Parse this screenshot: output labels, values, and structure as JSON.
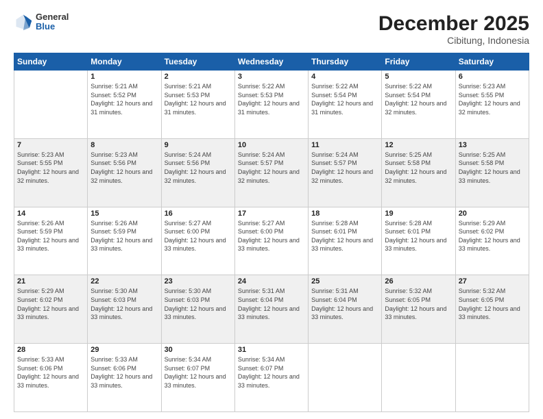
{
  "header": {
    "logo_general": "General",
    "logo_blue": "Blue",
    "main_title": "December 2025",
    "subtitle": "Cibitung, Indonesia"
  },
  "calendar": {
    "days_of_week": [
      "Sunday",
      "Monday",
      "Tuesday",
      "Wednesday",
      "Thursday",
      "Friday",
      "Saturday"
    ],
    "weeks": [
      [
        {
          "day": "",
          "sunrise": "",
          "sunset": "",
          "daylight": ""
        },
        {
          "day": "1",
          "sunrise": "Sunrise: 5:21 AM",
          "sunset": "Sunset: 5:52 PM",
          "daylight": "Daylight: 12 hours and 31 minutes."
        },
        {
          "day": "2",
          "sunrise": "Sunrise: 5:21 AM",
          "sunset": "Sunset: 5:53 PM",
          "daylight": "Daylight: 12 hours and 31 minutes."
        },
        {
          "day": "3",
          "sunrise": "Sunrise: 5:22 AM",
          "sunset": "Sunset: 5:53 PM",
          "daylight": "Daylight: 12 hours and 31 minutes."
        },
        {
          "day": "4",
          "sunrise": "Sunrise: 5:22 AM",
          "sunset": "Sunset: 5:54 PM",
          "daylight": "Daylight: 12 hours and 31 minutes."
        },
        {
          "day": "5",
          "sunrise": "Sunrise: 5:22 AM",
          "sunset": "Sunset: 5:54 PM",
          "daylight": "Daylight: 12 hours and 32 minutes."
        },
        {
          "day": "6",
          "sunrise": "Sunrise: 5:23 AM",
          "sunset": "Sunset: 5:55 PM",
          "daylight": "Daylight: 12 hours and 32 minutes."
        }
      ],
      [
        {
          "day": "7",
          "sunrise": "Sunrise: 5:23 AM",
          "sunset": "Sunset: 5:55 PM",
          "daylight": "Daylight: 12 hours and 32 minutes."
        },
        {
          "day": "8",
          "sunrise": "Sunrise: 5:23 AM",
          "sunset": "Sunset: 5:56 PM",
          "daylight": "Daylight: 12 hours and 32 minutes."
        },
        {
          "day": "9",
          "sunrise": "Sunrise: 5:24 AM",
          "sunset": "Sunset: 5:56 PM",
          "daylight": "Daylight: 12 hours and 32 minutes."
        },
        {
          "day": "10",
          "sunrise": "Sunrise: 5:24 AM",
          "sunset": "Sunset: 5:57 PM",
          "daylight": "Daylight: 12 hours and 32 minutes."
        },
        {
          "day": "11",
          "sunrise": "Sunrise: 5:24 AM",
          "sunset": "Sunset: 5:57 PM",
          "daylight": "Daylight: 12 hours and 32 minutes."
        },
        {
          "day": "12",
          "sunrise": "Sunrise: 5:25 AM",
          "sunset": "Sunset: 5:58 PM",
          "daylight": "Daylight: 12 hours and 32 minutes."
        },
        {
          "day": "13",
          "sunrise": "Sunrise: 5:25 AM",
          "sunset": "Sunset: 5:58 PM",
          "daylight": "Daylight: 12 hours and 33 minutes."
        }
      ],
      [
        {
          "day": "14",
          "sunrise": "Sunrise: 5:26 AM",
          "sunset": "Sunset: 5:59 PM",
          "daylight": "Daylight: 12 hours and 33 minutes."
        },
        {
          "day": "15",
          "sunrise": "Sunrise: 5:26 AM",
          "sunset": "Sunset: 5:59 PM",
          "daylight": "Daylight: 12 hours and 33 minutes."
        },
        {
          "day": "16",
          "sunrise": "Sunrise: 5:27 AM",
          "sunset": "Sunset: 6:00 PM",
          "daylight": "Daylight: 12 hours and 33 minutes."
        },
        {
          "day": "17",
          "sunrise": "Sunrise: 5:27 AM",
          "sunset": "Sunset: 6:00 PM",
          "daylight": "Daylight: 12 hours and 33 minutes."
        },
        {
          "day": "18",
          "sunrise": "Sunrise: 5:28 AM",
          "sunset": "Sunset: 6:01 PM",
          "daylight": "Daylight: 12 hours and 33 minutes."
        },
        {
          "day": "19",
          "sunrise": "Sunrise: 5:28 AM",
          "sunset": "Sunset: 6:01 PM",
          "daylight": "Daylight: 12 hours and 33 minutes."
        },
        {
          "day": "20",
          "sunrise": "Sunrise: 5:29 AM",
          "sunset": "Sunset: 6:02 PM",
          "daylight": "Daylight: 12 hours and 33 minutes."
        }
      ],
      [
        {
          "day": "21",
          "sunrise": "Sunrise: 5:29 AM",
          "sunset": "Sunset: 6:02 PM",
          "daylight": "Daylight: 12 hours and 33 minutes."
        },
        {
          "day": "22",
          "sunrise": "Sunrise: 5:30 AM",
          "sunset": "Sunset: 6:03 PM",
          "daylight": "Daylight: 12 hours and 33 minutes."
        },
        {
          "day": "23",
          "sunrise": "Sunrise: 5:30 AM",
          "sunset": "Sunset: 6:03 PM",
          "daylight": "Daylight: 12 hours and 33 minutes."
        },
        {
          "day": "24",
          "sunrise": "Sunrise: 5:31 AM",
          "sunset": "Sunset: 6:04 PM",
          "daylight": "Daylight: 12 hours and 33 minutes."
        },
        {
          "day": "25",
          "sunrise": "Sunrise: 5:31 AM",
          "sunset": "Sunset: 6:04 PM",
          "daylight": "Daylight: 12 hours and 33 minutes."
        },
        {
          "day": "26",
          "sunrise": "Sunrise: 5:32 AM",
          "sunset": "Sunset: 6:05 PM",
          "daylight": "Daylight: 12 hours and 33 minutes."
        },
        {
          "day": "27",
          "sunrise": "Sunrise: 5:32 AM",
          "sunset": "Sunset: 6:05 PM",
          "daylight": "Daylight: 12 hours and 33 minutes."
        }
      ],
      [
        {
          "day": "28",
          "sunrise": "Sunrise: 5:33 AM",
          "sunset": "Sunset: 6:06 PM",
          "daylight": "Daylight: 12 hours and 33 minutes."
        },
        {
          "day": "29",
          "sunrise": "Sunrise: 5:33 AM",
          "sunset": "Sunset: 6:06 PM",
          "daylight": "Daylight: 12 hours and 33 minutes."
        },
        {
          "day": "30",
          "sunrise": "Sunrise: 5:34 AM",
          "sunset": "Sunset: 6:07 PM",
          "daylight": "Daylight: 12 hours and 33 minutes."
        },
        {
          "day": "31",
          "sunrise": "Sunrise: 5:34 AM",
          "sunset": "Sunset: 6:07 PM",
          "daylight": "Daylight: 12 hours and 33 minutes."
        },
        {
          "day": "",
          "sunrise": "",
          "sunset": "",
          "daylight": ""
        },
        {
          "day": "",
          "sunrise": "",
          "sunset": "",
          "daylight": ""
        },
        {
          "day": "",
          "sunrise": "",
          "sunset": "",
          "daylight": ""
        }
      ]
    ]
  }
}
